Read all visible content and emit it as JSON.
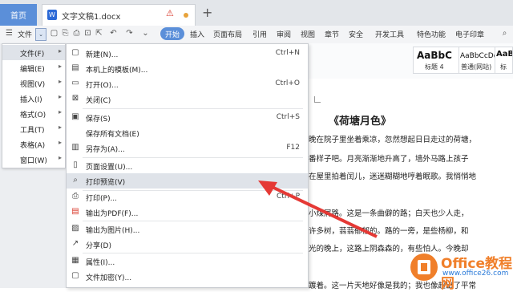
{
  "tabbar": {
    "home_tab": "首页",
    "doc_tab": "文字文稿1.docx",
    "new_tab_icon": "plus-icon"
  },
  "menubar": {
    "file_label": "文件",
    "start_label": "开始",
    "items": [
      "插入",
      "页面布局",
      "引用",
      "审阅",
      "视图",
      "章节",
      "安全",
      "开发工具",
      "特色功能",
      "电子印章"
    ],
    "search_icon": "search-icon"
  },
  "ribbon": {
    "styles": [
      {
        "sample": "AaBbC",
        "name": "标题 4"
      },
      {
        "sample": "AaBbCcDd",
        "name": "普通(网站)"
      },
      {
        "sample": "AaBl",
        "name": "标"
      }
    ]
  },
  "main_menu": {
    "items": [
      {
        "label": "文件(F)",
        "arrow": "▸"
      },
      {
        "label": "编辑(E)",
        "arrow": "▸"
      },
      {
        "label": "视图(V)",
        "arrow": "▸"
      },
      {
        "label": "插入(I)",
        "arrow": "▸"
      },
      {
        "label": "格式(O)",
        "arrow": "▸"
      },
      {
        "label": "工具(T)",
        "arrow": "▸"
      },
      {
        "label": "表格(A)",
        "arrow": "▸"
      },
      {
        "label": "窗口(W)",
        "arrow": "▸"
      }
    ]
  },
  "file_submenu": {
    "items": [
      {
        "label": "新建(N)...",
        "shortcut": "Ctrl+N",
        "icon": "new-doc-icon"
      },
      {
        "label": "本机上的模板(M)...",
        "shortcut": "",
        "icon": "template-icon"
      },
      {
        "label": "打开(O)...",
        "shortcut": "Ctrl+O",
        "icon": "folder-open-icon"
      },
      {
        "label": "关闭(C)",
        "shortcut": "",
        "icon": "close-doc-icon"
      },
      {
        "label": "保存(S)",
        "shortcut": "Ctrl+S",
        "icon": "save-icon"
      },
      {
        "label": "保存所有文档(E)",
        "shortcut": "",
        "icon": ""
      },
      {
        "label": "另存为(A)...",
        "shortcut": "F12",
        "icon": "save-as-icon"
      },
      {
        "label": "页面设置(U)...",
        "shortcut": "",
        "icon": "page-setup-icon"
      },
      {
        "label": "打印预览(V)",
        "shortcut": "",
        "icon": "print-preview-icon"
      },
      {
        "label": "打印(P)...",
        "shortcut": "Ctrl+P",
        "icon": "print-icon"
      },
      {
        "label": "输出为PDF(F)...",
        "shortcut": "",
        "icon": "pdf-icon"
      },
      {
        "label": "输出为图片(H)...",
        "shortcut": "",
        "icon": "image-export-icon"
      },
      {
        "label": "分享(D)",
        "shortcut": "",
        "icon": "share-icon"
      },
      {
        "label": "属性(I)...",
        "shortcut": "",
        "icon": "properties-icon"
      },
      {
        "label": "文件加密(Y)...",
        "shortcut": "",
        "icon": "encrypt-icon"
      }
    ]
  },
  "document": {
    "title": "《荷塘月色》",
    "lines": [
      "晚在院子里坐着乘凉，忽然想起日日走过的荷塘，",
      "番样子吧。月亮渐渐地升高了，墙外马路上孩子",
      "在屋里拍着闰儿，迷迷糊糊地哼着眠歌。我悄悄地",
      "小煤屑路。这是一条曲僻的路；白天也少人走，",
      "许多树，蓊蓊郁郁的。路的一旁，是些杨柳，和",
      "光的晚上，这路上阴森森的，有些怕人。今晚却",
      "踱着。这一片天地好像是我的；我也像超出了平常"
    ]
  },
  "watermark": {
    "brand": "Office教程网",
    "url": "www.office26.com"
  },
  "colors": {
    "accent": "#5b8fd9",
    "annotation_arrow": "#e53935",
    "watermark_orange": "#f07f2a"
  }
}
